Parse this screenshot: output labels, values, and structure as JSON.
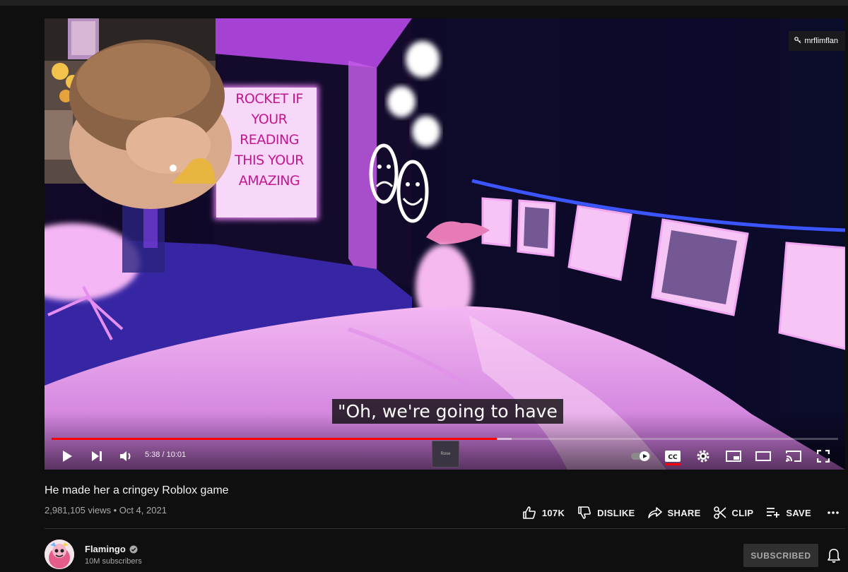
{
  "video": {
    "watermark": "mrflimflan",
    "sign_lines": [
      "ROCKET IF",
      "YOUR",
      "READING",
      "THIS YOUR",
      "AMAZING"
    ],
    "caption": "\"Oh, we're going to have",
    "preview_label": "Rose",
    "progress": {
      "played": 0.566,
      "buffered": 0.585
    }
  },
  "controls": {
    "time": "5:38 / 10:01",
    "icons": [
      "play-icon",
      "next-icon",
      "volume-icon",
      "autoplay-toggle",
      "cc-icon",
      "settings-icon",
      "miniplayer-icon",
      "theater-icon",
      "cast-icon",
      "fullscreen-icon"
    ]
  },
  "info": {
    "title": "He made her a cringey Roblox game",
    "meta": "2,981,105 views • Oct 4, 2021",
    "actions": {
      "like": "107K",
      "dislike": "DISLIKE",
      "share": "SHARE",
      "clip": "CLIP",
      "save": "SAVE"
    }
  },
  "channel": {
    "name": "Flamingo",
    "subscribers": "10M subscribers",
    "subscribe_label": "SUBSCRIBED"
  },
  "colors": {
    "accent": "#ff0000",
    "background": "#0f0f0f",
    "neon": "#e08ef0"
  }
}
